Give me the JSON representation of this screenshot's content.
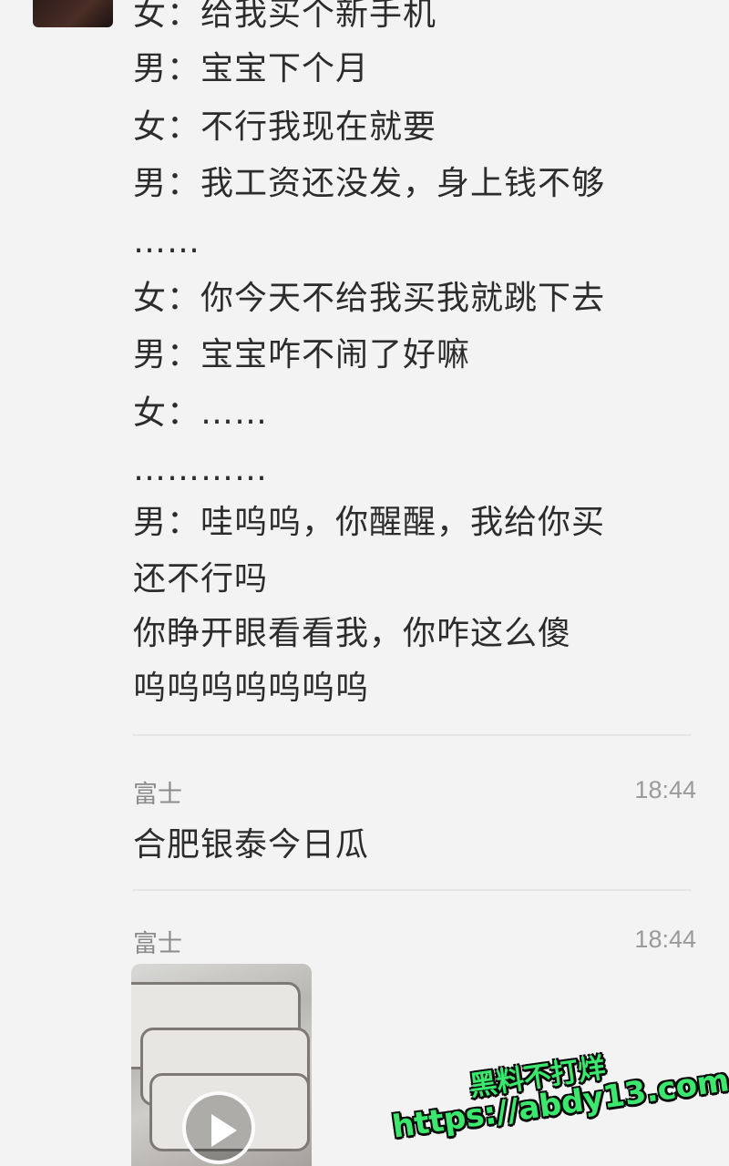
{
  "conversation": {
    "lines": [
      "女：给我买个新手机",
      "男：宝宝下个月",
      "女：不行我现在就要",
      "男：我工资还没发，身上钱不够",
      "……",
      "女：你今天不给我买我就跳下去",
      "男：宝宝咋不闹了好嘛",
      "女：……",
      "…………",
      "男：哇呜呜，你醒醒，我给你买",
      "还不行吗",
      "你睁开眼看看我，你咋这么傻",
      "呜呜呜呜呜呜呜"
    ]
  },
  "message1": {
    "sender": "富士",
    "time": "18:44",
    "text": "合肥银泰今日瓜"
  },
  "message2": {
    "sender": "富士",
    "time": "18:44",
    "media": "video"
  },
  "watermark": {
    "title": "黑料不打烊",
    "url": "https://abdy13.com"
  },
  "colors": {
    "watermark_fill": "#3be86d",
    "text": "#2c2c2c",
    "meta": "#8b8b8b"
  }
}
